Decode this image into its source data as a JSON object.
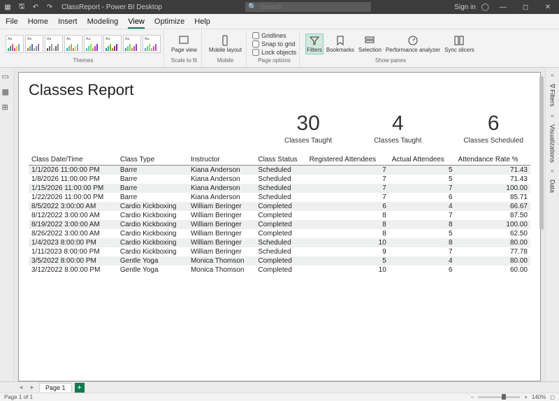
{
  "titlebar": {
    "title": "ClassReport - Power BI Desktop",
    "search_placeholder": "Search",
    "signin": "Sign in"
  },
  "menu": {
    "file": "File",
    "home": "Home",
    "insert": "Insert",
    "modeling": "Modeling",
    "view": "View",
    "optimize": "Optimize",
    "help": "Help"
  },
  "ribbon": {
    "themes": "Themes",
    "page_view": "Page view",
    "mobile_layout": "Mobile layout",
    "scale_to_fit": "Scale to fit",
    "mobile": "Mobile",
    "gridlines": "Gridlines",
    "snap_to_grid": "Snap to grid",
    "lock_objects": "Lock objects",
    "page_options": "Page options",
    "filters": "Filters",
    "bookmarks": "Bookmarks",
    "selection": "Selection",
    "performance_analyzer": "Performance analyzer",
    "sync_slicers": "Sync slicers",
    "show_panes": "Show panes"
  },
  "right_panes": {
    "filters": "Filters",
    "visualizations": "Visualizations",
    "data": "Data"
  },
  "report": {
    "title": "Classes Report",
    "cards": [
      {
        "num": "30",
        "lab": "Classes Taught"
      },
      {
        "num": "4",
        "lab": "Classes Taught"
      },
      {
        "num": "6",
        "lab": "Classes Scheduled"
      }
    ],
    "columns": [
      "Class Date/Time",
      "Class Type",
      "Instructor",
      "Class Status",
      "Registered Attendees",
      "Actual Attendees",
      "Attendance Rate %"
    ],
    "rows": [
      [
        "1/1/2026 11:00:00 PM",
        "Barre",
        "Kiana Anderson",
        "Scheduled",
        "7",
        "5",
        "71.43"
      ],
      [
        "1/8/2026 11:00:00 PM",
        "Barre",
        "Kiana Anderson",
        "Scheduled",
        "7",
        "5",
        "71.43"
      ],
      [
        "1/15/2026 11:00:00 PM",
        "Barre",
        "Kiana Anderson",
        "Scheduled",
        "7",
        "7",
        "100.00"
      ],
      [
        "1/22/2026 11:00:00 PM",
        "Barre",
        "Kiana Anderson",
        "Scheduled",
        "7",
        "6",
        "85.71"
      ],
      [
        "8/5/2022 3:00:00 AM",
        "Cardio Kickboxing",
        "William Beringer",
        "Completed",
        "6",
        "4",
        "66.67"
      ],
      [
        "8/12/2022 3:00:00 AM",
        "Cardio Kickboxing",
        "William Beringer",
        "Completed",
        "8",
        "7",
        "87.50"
      ],
      [
        "8/19/2022 3:00:00 AM",
        "Cardio Kickboxing",
        "William Beringer",
        "Completed",
        "8",
        "8",
        "100.00"
      ],
      [
        "8/26/2022 3:00:00 AM",
        "Cardio Kickboxing",
        "William Beringer",
        "Completed",
        "8",
        "5",
        "62.50"
      ],
      [
        "1/4/2023 8:00:00 PM",
        "Cardio Kickboxing",
        "William Beringer",
        "Scheduled",
        "10",
        "8",
        "80.00"
      ],
      [
        "1/11/2023 8:00:00 PM",
        "Cardio Kickboxing",
        "William Beringer",
        "Scheduled",
        "9",
        "7",
        "77.78"
      ],
      [
        "3/5/2022 8:00:00 PM",
        "Gentle Yoga",
        "Monica Thomson",
        "Completed",
        "5",
        "4",
        "80.00"
      ],
      [
        "3/12/2022 8:00:00 PM",
        "Gentle Yoga",
        "Monica Thomson",
        "Completed",
        "10",
        "6",
        "60.00"
      ]
    ]
  },
  "footer": {
    "tab": "Page 1",
    "page_info": "Page 1 of 1",
    "zoom": "140%"
  },
  "theme_colors": [
    [
      "#3a7",
      "#38c",
      "#e55",
      "#c3c",
      "#fb3",
      "#5ad"
    ],
    [
      "#a66",
      "#6a6",
      "#66a",
      "#aa6",
      "#6aa",
      "#a6a"
    ],
    [
      "#555",
      "#777",
      "#999",
      "#bbb",
      "#666",
      "#888"
    ],
    [
      "#39d",
      "#3c9",
      "#e84",
      "#c5a",
      "#fc4",
      "#6bd"
    ],
    [
      "#3bd",
      "#3db",
      "#8d3",
      "#d83",
      "#d38",
      "#83d"
    ],
    [
      "#27b",
      "#2b7",
      "#7b2",
      "#b72",
      "#b27",
      "#72b"
    ],
    [
      "#48c",
      "#4c8",
      "#8c4",
      "#c84",
      "#c48",
      "#84c"
    ],
    [
      "#59d",
      "#5d9",
      "#9d5",
      "#d95",
      "#d59",
      "#95d"
    ]
  ]
}
